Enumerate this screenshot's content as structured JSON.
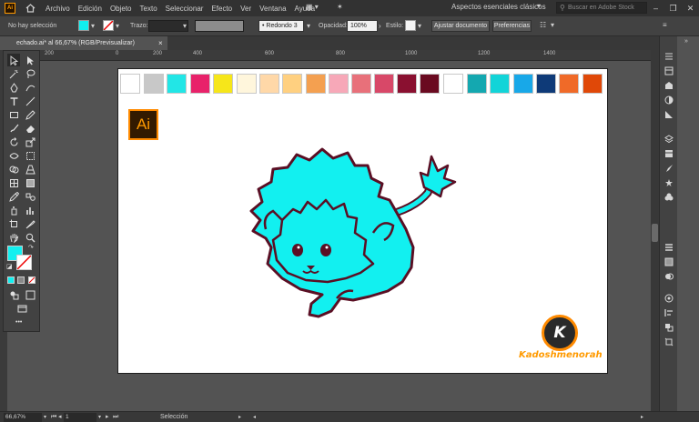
{
  "app": {
    "logo_text": "Ai",
    "menus": [
      "Archivo",
      "Edición",
      "Objeto",
      "Texto",
      "Seleccionar",
      "Efecto",
      "Ver",
      "Ventana",
      "Ayuda"
    ],
    "workspace": "Aspectos esenciales clásicos",
    "stock_search_placeholder": "Buscar en Adobe Stock",
    "window_controls": {
      "minimize": "–",
      "maximize": "❐",
      "close": "✕"
    }
  },
  "controlbar": {
    "selection_status": "No hay selección",
    "stroke_label": "Trazo:",
    "brush_profile": "Redondo 3 ...",
    "opacity_label": "Opacidad:",
    "opacity_value": "100%",
    "style_label": "Estilo:",
    "document_setup_button": "Ajustar documento",
    "preferences_button": "Preferencias"
  },
  "document": {
    "tab_title": "echado.ai* al 66,67% (RGB/Previsualizar)",
    "tab_close": "×"
  },
  "ruler": {
    "labels": [
      "200",
      "0",
      "200",
      "400",
      "600",
      "800",
      "1000",
      "1200",
      "1400"
    ]
  },
  "swatches": {
    "colors": [
      "#ffffff",
      "#c8c8c8",
      "#22e6e6",
      "#e8226a",
      "#f6e61a",
      "#fff6dc",
      "#ffd8a8",
      "#ffd080",
      "#f4a050",
      "#f7a8b8",
      "#e8707a",
      "#d84868",
      "#8a1030",
      "#6a0a20",
      "#ffffff",
      "#14a8b0",
      "#12d4d8",
      "#18a8e8",
      "#0e3a78",
      "#f06a28",
      "#e04808"
    ]
  },
  "canvas": {
    "ai_badge_text": "Ai",
    "watermark_letter": "K",
    "watermark_brand": "Kadoshmenorah",
    "lion_fill": "#12f0f0",
    "lion_outline": "#5a0f24"
  },
  "toolbar": {
    "fill_color": "#12f0f0",
    "more_tools": "•••"
  },
  "statusbar": {
    "zoom": "66,67%",
    "artboard_number": "1",
    "tool_status": "Selección"
  }
}
